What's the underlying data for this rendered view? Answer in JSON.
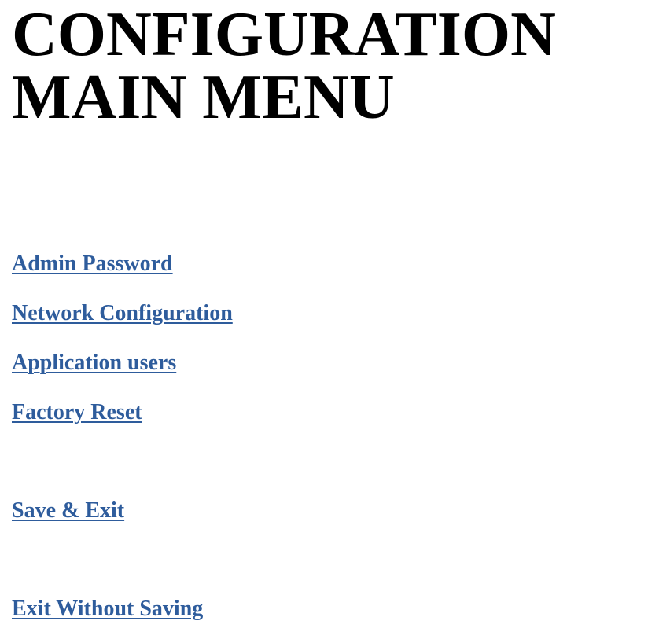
{
  "page": {
    "title_line1": "CONFIGURATION",
    "title_line2": "MAIN MENU"
  },
  "menu": {
    "items": [
      {
        "label": "Admin Password"
      },
      {
        "label": "Network Configuration"
      },
      {
        "label": "Application users"
      },
      {
        "label": "Factory Reset"
      }
    ],
    "save_exit_label": "Save & Exit",
    "exit_without_saving_label": "Exit Without Saving"
  },
  "colors": {
    "link": "#2e5c9c",
    "text": "#000000",
    "background": "#ffffff"
  }
}
